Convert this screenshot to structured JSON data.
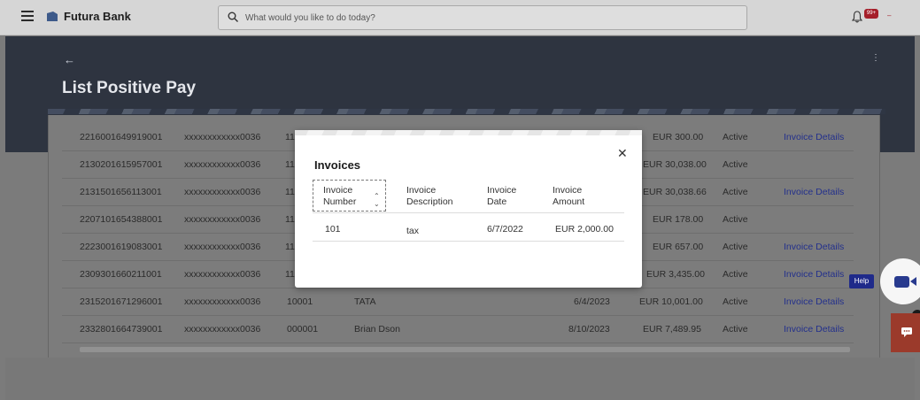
{
  "app": {
    "brand": "Futura Bank",
    "search_placeholder": "What would you like to do today?",
    "notification_badge": "99+"
  },
  "page": {
    "title": "List Positive Pay"
  },
  "table": {
    "rows": [
      {
        "c1": "2216001649919001",
        "c2": "xxxxxxxxxxxx0036",
        "c3": "11",
        "c4": "",
        "c5": "",
        "amount": "EUR 300.00",
        "status": "Active",
        "link": "Invoice Details"
      },
      {
        "c1": "2130201615957001",
        "c2": "xxxxxxxxxxxx0036",
        "c3": "11",
        "c4": "",
        "c5": "",
        "amount": "EUR 30,038.00",
        "status": "Active",
        "link": ""
      },
      {
        "c1": "2131501656113001",
        "c2": "xxxxxxxxxxxx0036",
        "c3": "11",
        "c4": "",
        "c5": "",
        "amount": "EUR 30,038.66",
        "status": "Active",
        "link": "Invoice Details"
      },
      {
        "c1": "2207101654388001",
        "c2": "xxxxxxxxxxxx0036",
        "c3": "11",
        "c4": "",
        "c5": "",
        "amount": "EUR 178.00",
        "status": "Active",
        "link": ""
      },
      {
        "c1": "2223001619083001",
        "c2": "xxxxxxxxxxxx0036",
        "c3": "11",
        "c4": "",
        "c5": "",
        "amount": "EUR 657.00",
        "status": "Active",
        "link": "Invoice Details"
      },
      {
        "c1": "2309301660211001",
        "c2": "xxxxxxxxxxxx0036",
        "c3": "11",
        "c4": "",
        "c5": "",
        "amount": "EUR 3,435.00",
        "status": "Active",
        "link": "Invoice Details"
      },
      {
        "c1": "2315201671296001",
        "c2": "xxxxxxxxxxxx0036",
        "c3": "10001",
        "c4": "TATA",
        "c5": "6/4/2023",
        "amount": "EUR 10,001.00",
        "status": "Active",
        "link": "Invoice Details"
      },
      {
        "c1": "2332801664739001",
        "c2": "xxxxxxxxxxxx0036",
        "c3": "000001",
        "c4": "Brian Dson",
        "c5": "8/10/2023",
        "amount": "EUR 7,489.95",
        "status": "Active",
        "link": "Invoice Details"
      }
    ]
  },
  "modal": {
    "title": "Invoices",
    "headers": {
      "number": "Invoice Number",
      "description": "Invoice Description",
      "date": "Invoice Date",
      "amount": "Invoice Amount"
    },
    "rows": [
      {
        "number": "101",
        "description": "tax",
        "date": "6/7/2022",
        "amount": "EUR 2,000.00"
      }
    ]
  },
  "widgets": {
    "help_label": "Help"
  },
  "icons": [
    "menu-icon",
    "bank-logo-icon",
    "search-icon",
    "bell-icon",
    "back-arrow-icon",
    "kebab-icon",
    "close-icon",
    "sort-icon",
    "video-icon",
    "chat-icon"
  ]
}
